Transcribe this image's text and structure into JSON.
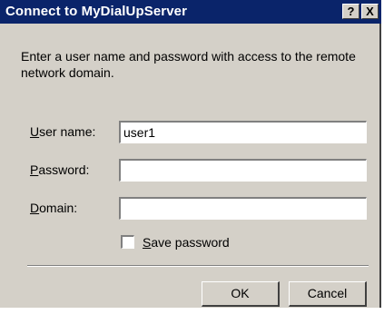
{
  "window": {
    "title": "Connect to MyDialUpServer",
    "help_glyph": "?",
    "close_glyph": "X"
  },
  "description": "Enter a user name and password with access to the remote network domain.",
  "fields": {
    "username": {
      "label_key": "U",
      "label_rest": "ser name:",
      "value": "user1"
    },
    "password": {
      "label_key": "P",
      "label_rest": "assword:",
      "value": ""
    },
    "domain": {
      "label_key": "D",
      "label_rest": "omain:",
      "value": ""
    }
  },
  "save_password": {
    "label_key": "S",
    "label_rest": "ave password",
    "checked": false
  },
  "buttons": {
    "ok": "OK",
    "cancel": "Cancel"
  },
  "colors": {
    "titlebar": "#0a246a",
    "face": "#d4d0c8"
  }
}
